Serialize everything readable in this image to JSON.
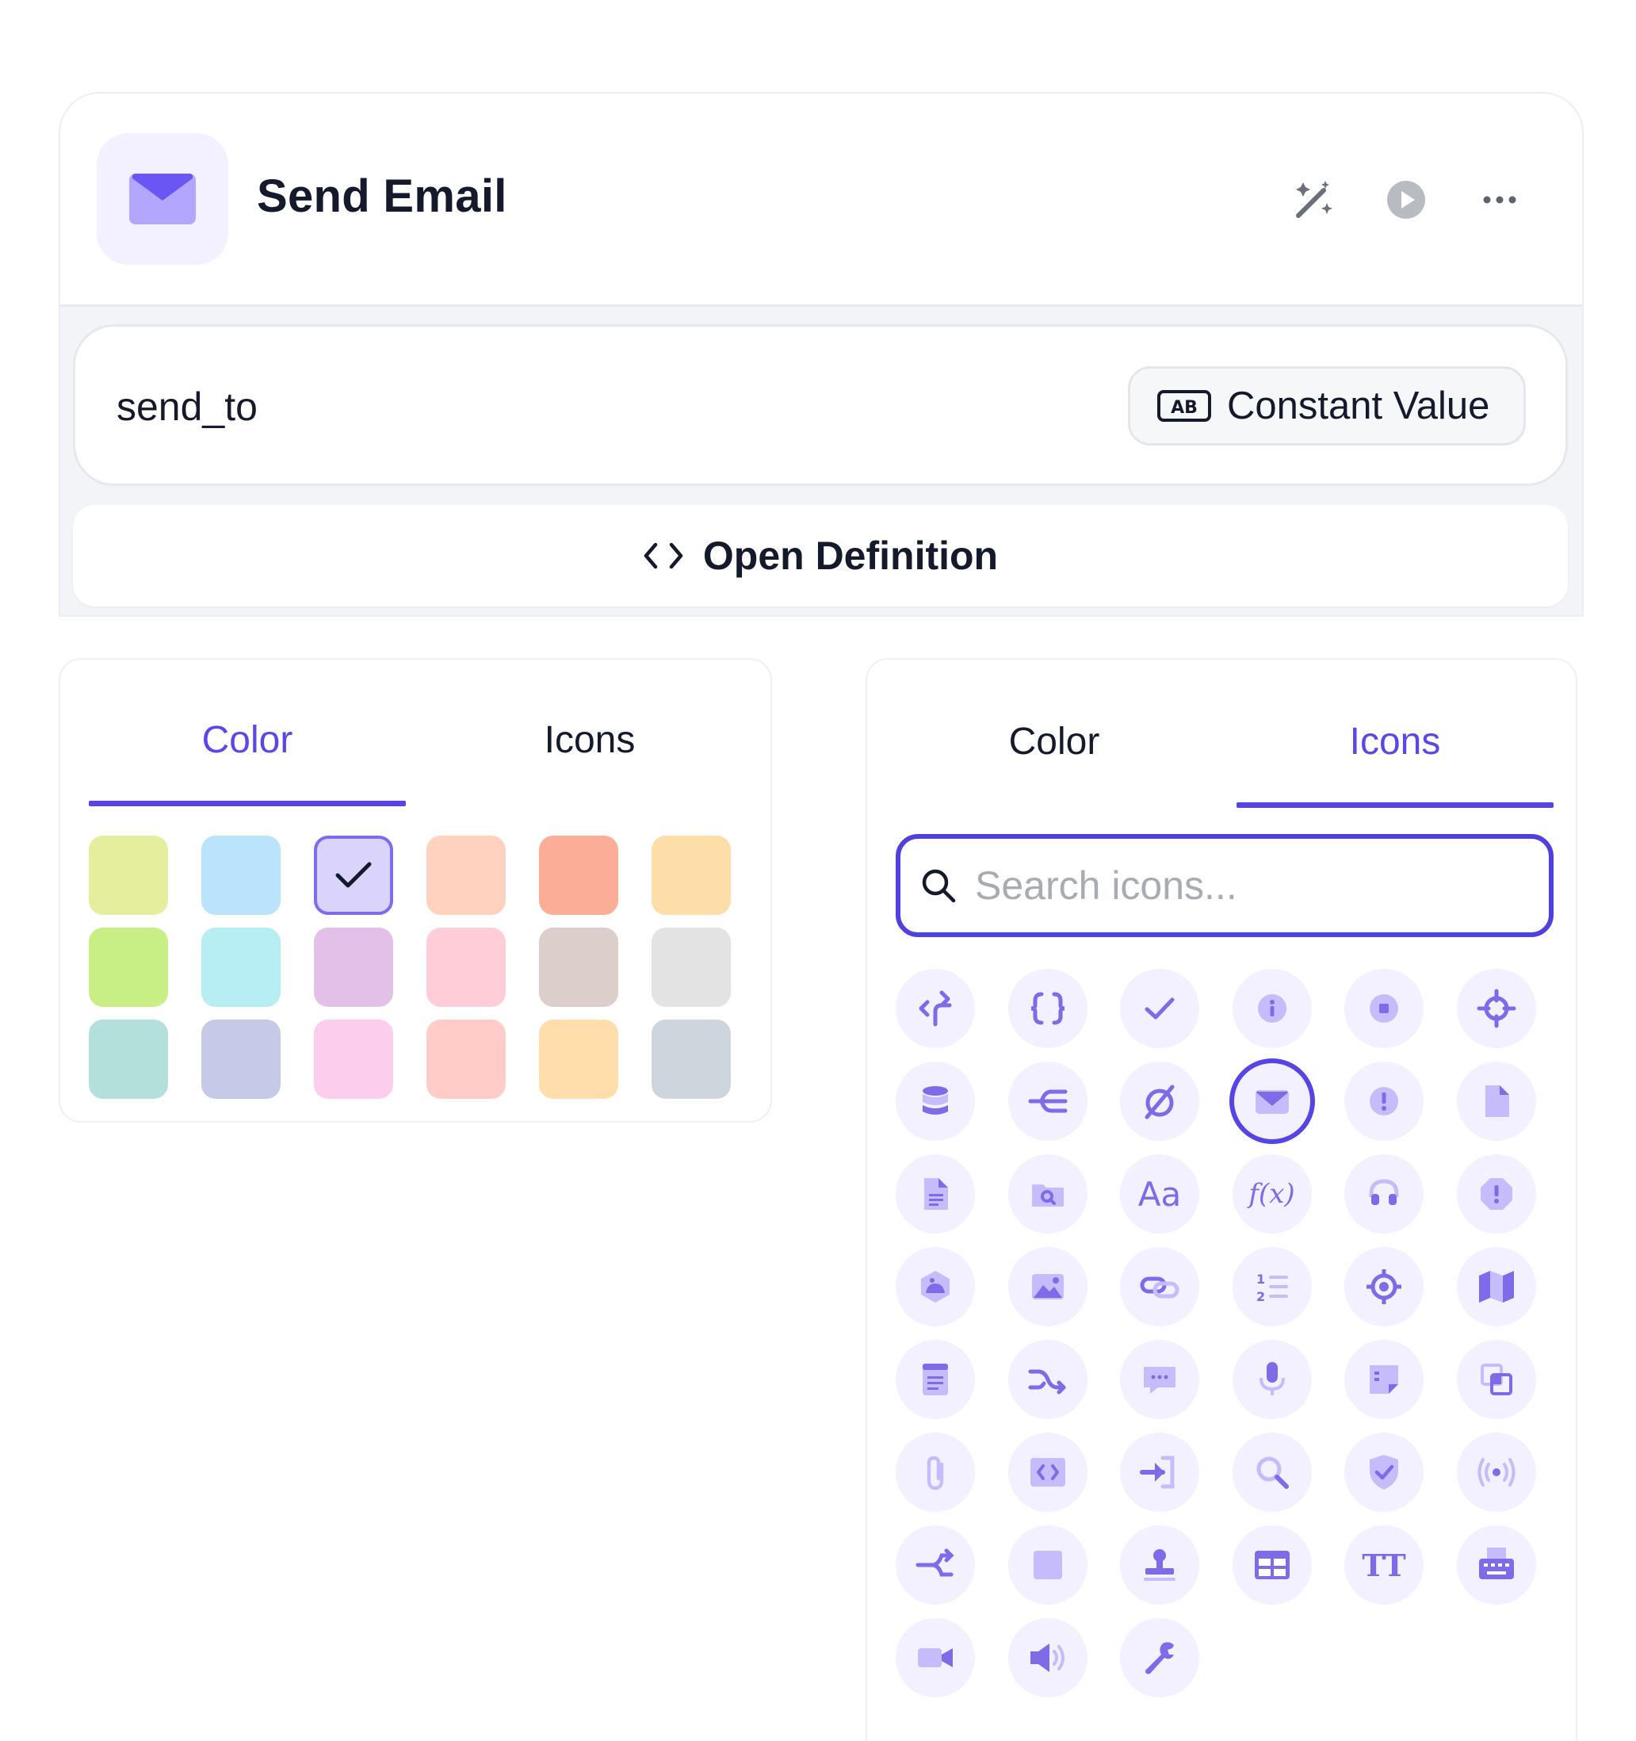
{
  "node": {
    "title": "Send Email",
    "icon": "envelope-icon",
    "actions": [
      "magic-wand-icon",
      "play-icon",
      "more-horizontal-icon"
    ],
    "param": {
      "name": "send_to",
      "mode_label": "Constant Value",
      "mode_icon": "text-ab-icon"
    },
    "open_definition_label": "Open Definition"
  },
  "color_panel": {
    "tabs": [
      {
        "label": "Color",
        "active": true
      },
      {
        "label": "Icons",
        "active": false
      }
    ],
    "swatches": [
      "#e5ee9c",
      "#b9e4fb",
      "#dad4fd",
      "#ffd2bf",
      "#fbad97",
      "#fddea9",
      "#c7ef86",
      "#b6eef3",
      "#e2c0e8",
      "#ffcdd8",
      "#dcceca",
      "#e3e3e3",
      "#b3e0db",
      "#c6cae8",
      "#fdcdee",
      "#ffccc7",
      "#ffdeab",
      "#cfd5dc"
    ],
    "selected_index": 2
  },
  "icon_panel": {
    "tabs": [
      {
        "label": "Color",
        "active": false
      },
      {
        "label": "Icons",
        "active": true
      }
    ],
    "search_placeholder": "Search icons...",
    "icons": [
      "api-icon",
      "braces-icon",
      "check-icon",
      "info-icon",
      "stop-icon",
      "crosshair-icon",
      "database-icon",
      "merge-icon",
      "empty-set-icon",
      "envelope-icon",
      "alert-icon",
      "file-icon",
      "file-text-icon",
      "folder-search-icon",
      "font-icon",
      "function-icon",
      "headset-icon",
      "alert-octagon-icon",
      "cookie-icon",
      "image-icon",
      "link-icon",
      "ordered-list-icon",
      "location-icon",
      "map-icon",
      "notes-icon",
      "shuffle-icon",
      "chat-icon",
      "microphone-icon",
      "sticky-note-icon",
      "copy-icon",
      "paperclip-icon",
      "code-icon",
      "sign-in-icon",
      "search-icon",
      "shield-icon",
      "broadcast-icon",
      "share-icon",
      "square-icon",
      "stamp-icon",
      "table-icon",
      "text-size-icon",
      "typewriter-icon",
      "video-icon",
      "volume-icon",
      "wrench-icon"
    ],
    "selected_icon": "envelope-icon",
    "font_glyph": "Aa",
    "function_glyph": "f(x)",
    "text_size_glyph": "TT"
  },
  "colors": {
    "accent": "#5544e6",
    "icon_fill": "#7d6be8",
    "icon_bg": "#f3f0ff"
  }
}
